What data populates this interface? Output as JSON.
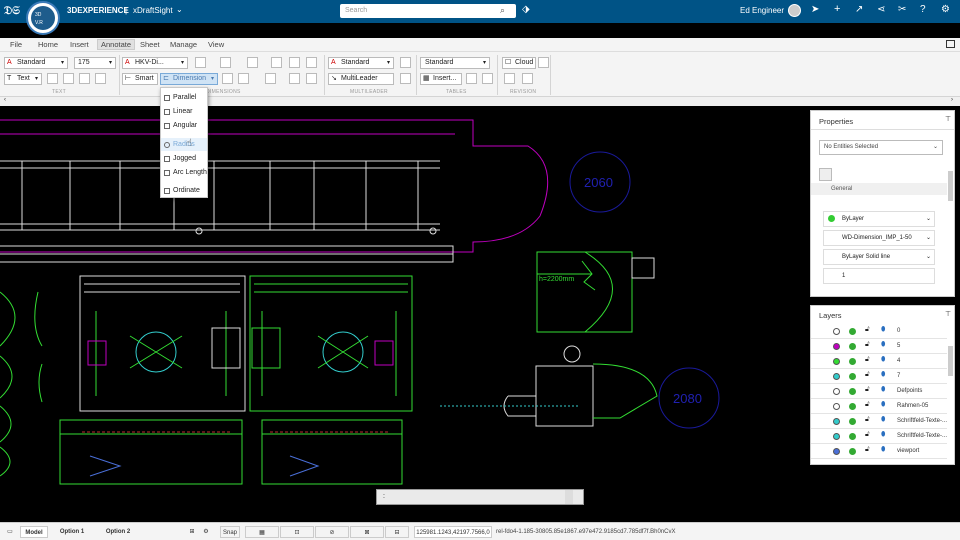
{
  "app": {
    "brand": "3DEXPERIENCE",
    "separator": "|",
    "app_name": "xDraftSight",
    "compass_text": "V.R",
    "compass_label": "3D",
    "search_placeholder": "Search",
    "user": "Ed Engineer"
  },
  "menu": [
    "File",
    "Home",
    "Insert",
    "Annotate",
    "Sheet",
    "Manage",
    "View"
  ],
  "active_menu": "Annotate",
  "ribbon": {
    "text_style": "Standard",
    "text_height": "175",
    "text_btn": "Text",
    "dim_style": "HKV-Di...",
    "smart": "Smart",
    "dimension": "Dimension",
    "ml_style": "Standard",
    "multileader": "MultiLeader",
    "table_style": "Standard",
    "insert": "Insert...",
    "cloud": "Cloud",
    "groups": [
      "TEXT",
      "DIMENSIONS",
      "MULTILEADER",
      "TABLES",
      "REVISION"
    ]
  },
  "dimension_menu": [
    "Parallel",
    "Linear",
    "Angular",
    "Radius",
    "Jogged",
    "Arc Length",
    "Ordinate"
  ],
  "highlighted_item": "Radius",
  "drawing": {
    "label_height": "h=2200mm",
    "room1": "2060",
    "room2": "2080"
  },
  "properties": {
    "title": "Properties",
    "selection": "No Entities Selected",
    "section": "General",
    "rows": [
      "ByLayer",
      "WD-Dimension_IMP_1-50",
      "ByLayer   Solid line",
      "1"
    ]
  },
  "layers": {
    "title": "Layers",
    "rows": [
      {
        "name": "0",
        "color": "#ffffff"
      },
      {
        "name": "5",
        "color": "#c000c0"
      },
      {
        "name": "4",
        "color": "#33dd33"
      },
      {
        "name": "7",
        "color": "#33cccc"
      },
      {
        "name": "Defpoints",
        "color": "#ffffff"
      },
      {
        "name": "Rahmen-05",
        "color": "#ffffff"
      },
      {
        "name": "Schriftfeld-Texte-...",
        "color": "#33cccc"
      },
      {
        "name": "Schriftfeld-Texte-...",
        "color": "#33cccc"
      },
      {
        "name": "viewport",
        "color": "#4a6fd8"
      }
    ]
  },
  "status": {
    "model": "Model",
    "opt1": "Option 1",
    "opt2": "Option 2",
    "snap": "Snap",
    "coords": "125981.1243,42197.7566,0",
    "rel": "rel-fdo4-1.185-30805.85e1867.e97e472.9185cd7.785df7f.Bh0nCvX"
  },
  "cmd": ":"
}
